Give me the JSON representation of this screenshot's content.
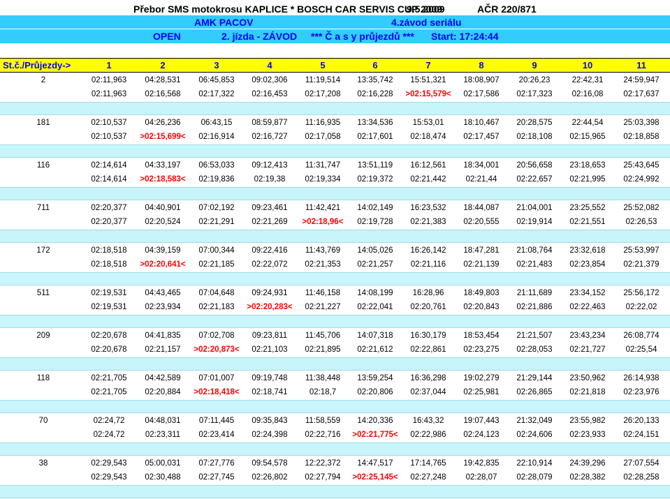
{
  "header": {
    "line1": "Přebor SMS motokrosu KAPLICE * BOSCH CAR SERVIS CUP 2009",
    "date": "9.5.2009",
    "permit": "AČR 220/871",
    "club": "AMK PACOV",
    "round": "4.závod seriálu",
    "class": "OPEN",
    "session": "2. jízda  -  ZÁVOD",
    "title_laps": "***  Č  a  s  y   průjezdů  ***",
    "start": "Start:  17:24:44"
  },
  "colors": {
    "header_band": "#33ccff",
    "column_header": "#ffff00",
    "separator": "#c8f4fb",
    "best_lap": "#ff0000",
    "blue_text": "#0000ff"
  },
  "table": {
    "corner_label": "St.č./Průjezdy->",
    "laps": [
      "1",
      "2",
      "3",
      "4",
      "5",
      "6",
      "7",
      "8",
      "9",
      "10",
      "11"
    ],
    "riders": [
      {
        "number": "2",
        "cumulative": [
          "02:11,963",
          "04:28,531",
          "06:45,853",
          "09:02,306",
          "11:19,514",
          "13:35,742",
          "15:51,321",
          "18:08,907",
          "20:26,23",
          "22:42,31",
          "24:59,947"
        ],
        "laps": [
          "02:11,963",
          "02:16,568",
          "02:17,322",
          "02:16,453",
          "02:17,208",
          "02:16,228",
          ">02:15,579<",
          "02:17,586",
          "02:17,323",
          "02:16,08",
          "02:17,637"
        ],
        "best_index": 6
      },
      {
        "number": "181",
        "cumulative": [
          "02:10,537",
          "04:26,236",
          "06:43,15",
          "08:59,877",
          "11:16,935",
          "13:34,536",
          "15:53,01",
          "18:10,467",
          "20:28,575",
          "22:44,54",
          "25:03,398"
        ],
        "laps": [
          "02:10,537",
          ">02:15,699<",
          "02:16,914",
          "02:16,727",
          "02:17,058",
          "02:17,601",
          "02:18,474",
          "02:17,457",
          "02:18,108",
          "02:15,965",
          "02:18,858"
        ],
        "best_index": 1
      },
      {
        "number": "116",
        "cumulative": [
          "02:14,614",
          "04:33,197",
          "06:53,033",
          "09:12,413",
          "11:31,747",
          "13:51,119",
          "16:12,561",
          "18:34,001",
          "20:56,658",
          "23:18,653",
          "25:43,645"
        ],
        "laps": [
          "02:14,614",
          ">02:18,583<",
          "02:19,836",
          "02:19,38",
          "02:19,334",
          "02:19,372",
          "02:21,442",
          "02:21,44",
          "02:22,657",
          "02:21,995",
          "02:24,992"
        ],
        "best_index": 1
      },
      {
        "number": "711",
        "cumulative": [
          "02:20,377",
          "04:40,901",
          "07:02,192",
          "09:23,461",
          "11:42,421",
          "14:02,149",
          "16:23,532",
          "18:44,087",
          "21:04,001",
          "23:25,552",
          "25:52,082"
        ],
        "laps": [
          "02:20,377",
          "02:20,524",
          "02:21,291",
          "02:21,269",
          ">02:18,96<",
          "02:19,728",
          "02:21,383",
          "02:20,555",
          "02:19,914",
          "02:21,551",
          "02:26,53"
        ],
        "best_index": 4
      },
      {
        "number": "172",
        "cumulative": [
          "02:18,518",
          "04:39,159",
          "07:00,344",
          "09:22,416",
          "11:43,769",
          "14:05,026",
          "16:26,142",
          "18:47,281",
          "21:08,764",
          "23:32,618",
          "25:53,997"
        ],
        "laps": [
          "02:18,518",
          ">02:20,641<",
          "02:21,185",
          "02:22,072",
          "02:21,353",
          "02:21,257",
          "02:21,116",
          "02:21,139",
          "02:21,483",
          "02:23,854",
          "02:21,379"
        ],
        "best_index": 1
      },
      {
        "number": "511",
        "cumulative": [
          "02:19,531",
          "04:43,465",
          "07:04,648",
          "09:24,931",
          "11:46,158",
          "14:08,199",
          "16:28,96",
          "18:49,803",
          "21:11,689",
          "23:34,152",
          "25:56,172"
        ],
        "laps": [
          "02:19,531",
          "02:23,934",
          "02:21,183",
          ">02:20,283<",
          "02:21,227",
          "02:22,041",
          "02:20,761",
          "02:20,843",
          "02:21,886",
          "02:22,463",
          "02:22,02"
        ],
        "best_index": 3
      },
      {
        "number": "209",
        "cumulative": [
          "02:20,678",
          "04:41,835",
          "07:02,708",
          "09:23,811",
          "11:45,706",
          "14:07,318",
          "16:30,179",
          "18:53,454",
          "21:21,507",
          "23:43,234",
          "26:08,774"
        ],
        "laps": [
          "02:20,678",
          "02:21,157",
          ">02:20,873<",
          "02:21,103",
          "02:21,895",
          "02:21,612",
          "02:22,861",
          "02:23,275",
          "02:28,053",
          "02:21,727",
          "02:25,54"
        ],
        "best_index": 2
      },
      {
        "number": "118",
        "cumulative": [
          "02:21,705",
          "04:42,589",
          "07:01,007",
          "09:19,748",
          "11:38,448",
          "13:59,254",
          "16:36,298",
          "19:02,279",
          "21:29,144",
          "23:50,962",
          "26:14,938"
        ],
        "laps": [
          "02:21,705",
          "02:20,884",
          ">02:18,418<",
          "02:18,741",
          "02:18,7",
          "02:20,806",
          "02:37,044",
          "02:25,981",
          "02:26,865",
          "02:21,818",
          "02:23,976"
        ],
        "best_index": 2
      },
      {
        "number": "70",
        "cumulative": [
          "02:24,72",
          "04:48,031",
          "07:11,445",
          "09:35,843",
          "11:58,559",
          "14:20,336",
          "16:43,32",
          "19:07,443",
          "21:32,049",
          "23:55,982",
          "26:20,133"
        ],
        "laps": [
          "02:24,72",
          "02:23,311",
          "02:23,414",
          "02:24,398",
          "02:22,716",
          ">02:21,775<",
          "02:22,986",
          "02:24,123",
          "02:24,606",
          "02:23,933",
          "02:24,151"
        ],
        "best_index": 5
      },
      {
        "number": "38",
        "cumulative": [
          "02:29,543",
          "05:00,031",
          "07:27,776",
          "09:54,578",
          "12:22,372",
          "14:47,517",
          "17:14,765",
          "19:42,835",
          "22:10,914",
          "24:39,296",
          "27:07,554"
        ],
        "laps": [
          "02:29,543",
          "02:30,488",
          "02:27,745",
          "02:26,802",
          "02:27,794",
          ">02:25,145<",
          "02:27,248",
          "02:28,07",
          "02:28,079",
          "02:28,382",
          "02:28,258"
        ],
        "best_index": 5
      }
    ]
  }
}
